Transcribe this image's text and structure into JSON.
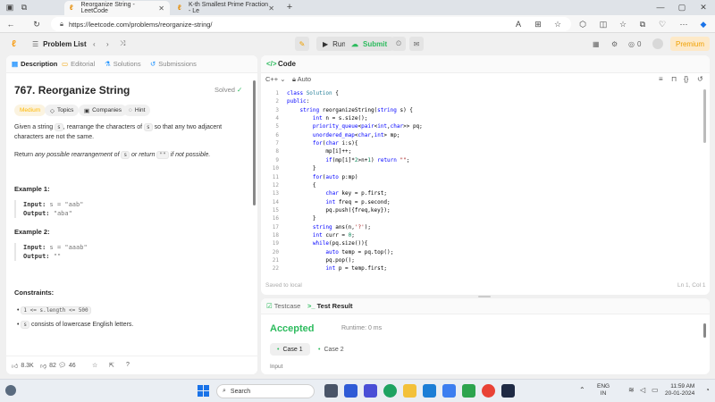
{
  "browser": {
    "tabs": [
      {
        "title": "Reorganize String - LeetCode",
        "active": true
      },
      {
        "title": "K-th Smallest Prime Fraction - Le",
        "active": false
      }
    ],
    "url": "https://leetcode.com/problems/reorganize-string/"
  },
  "lc_nav": {
    "problem_list": "Problem List",
    "run": "Run",
    "submit": "Submit",
    "coins": "0",
    "premium": "Premium"
  },
  "left": {
    "tabs": [
      "Description",
      "Editorial",
      "Solutions",
      "Submissions"
    ],
    "title": "767. Reorganize String",
    "solved": "Solved",
    "pills": [
      "Medium",
      "Topics",
      "Companies",
      "Hint"
    ],
    "desc1_a": "Given a string ",
    "desc1_code": "s",
    "desc1_b": ", rearrange the characters of ",
    "desc1_code2": "s",
    "desc1_c": " so that any two adjacent characters are not the same.",
    "desc2_a": "Return ",
    "desc2_b": "any possible rearrangement of ",
    "desc2_code": "s",
    "desc2_c": " or return ",
    "desc2_code2": "\"\"",
    "desc2_d": " if not possible.",
    "example1_title": "Example 1:",
    "example1_input_label": "Input:",
    "example1_input": "s = \"aab\"",
    "example1_output_label": "Output:",
    "example1_output": "\"aba\"",
    "example2_title": "Example 2:",
    "example2_input_label": "Input:",
    "example2_input": "s = \"aaab\"",
    "example2_output_label": "Output:",
    "example2_output": "\"\"",
    "constraints_title": "Constraints:",
    "constraint1": "1 <= s.length <= 500",
    "constraint2_code": "s",
    "constraint2_text": " consists of lowercase English letters.",
    "likes": "8.3K",
    "dislikes": "82",
    "comments": "46"
  },
  "editor": {
    "header": "Code",
    "language": "C++",
    "auto": "Auto",
    "saved": "Saved to local",
    "cursor": "Ln 1, Col 1",
    "lines": [
      "class Solution {",
      "public:",
      "    string reorganizeString(string s) {",
      "        int n = s.size();",
      "        priority_queue<pair<int,char>> pq;",
      "        unordered_map<char,int> mp;",
      "        for(char i:s){",
      "            mp[i]++;",
      "            if(mp[i]*2>n+1) return \"\";",
      "        }",
      "        for(auto p:mp)",
      "        {",
      "            char key = p.first;",
      "            int freq = p.second;",
      "            pq.push({freq,key});",
      "        }",
      "        string ans(n,'?');",
      "        int curr = 0;",
      "        while(pq.size()){",
      "            auto temp = pq.top();",
      "            pq.pop();",
      "            int p = temp.first;"
    ]
  },
  "tests": {
    "tab_testcase": "Testcase",
    "tab_result": "Test Result",
    "status": "Accepted",
    "runtime": "Runtime: 0 ms",
    "cases": [
      "Case 1",
      "Case 2"
    ],
    "input_label": "Input"
  },
  "taskbar": {
    "search": "Search",
    "lang1": "ENG",
    "lang2": "IN",
    "time": "11:59 AM",
    "date": "20-01-2024"
  }
}
